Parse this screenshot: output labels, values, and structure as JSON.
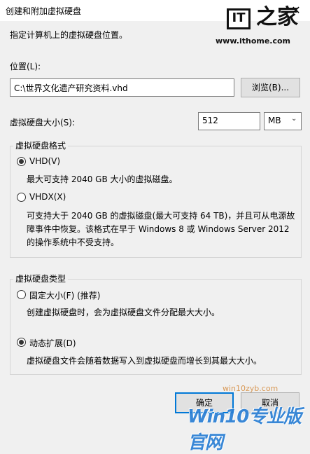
{
  "window": {
    "title": "创建和附加虚拟硬盘",
    "close_glyph": "✕"
  },
  "watermark_logo": {
    "mark": "IT",
    "cn": "之家",
    "url": "www.ithome.com"
  },
  "intro_text": "指定计算机上的虚拟硬盘位置。",
  "location": {
    "label": "位置(L):",
    "value": "C:\\世界文化遗产研究资料.vhd",
    "browse_label": "浏览(B)..."
  },
  "size": {
    "label": "虚拟硬盘大小(S):",
    "value": "512",
    "unit": "MB",
    "arrow": "⌄"
  },
  "format_group": {
    "title": "虚拟硬盘格式",
    "options": [
      {
        "label": "VHD(V)",
        "selected": true,
        "description": [
          "最大可支持 2040 GB 大小的虚拟磁盘。"
        ]
      },
      {
        "label": "VHDX(X)",
        "selected": false,
        "description": [
          "可支持大于 2040 GB 的虚拟磁盘(最大可支持 64 TB)，并且可从电源故",
          "障事件中恢复。该格式在早于 Windows 8 或 Windows Server 2012",
          "的操作系统中不受支持。"
        ]
      }
    ]
  },
  "type_group": {
    "title": "虚拟硬盘类型",
    "options": [
      {
        "label": "固定大小(F) (推荐)",
        "selected": false,
        "description": [
          "创建虚拟硬盘时，会为虚拟硬盘文件分配最大大小。"
        ]
      },
      {
        "label": "动态扩展(D)",
        "selected": true,
        "description": [
          "虚拟硬盘文件会随着数据写入到虚拟硬盘而增长到其最大大小。"
        ]
      }
    ]
  },
  "buttons": {
    "ok": "确定",
    "cancel": "取消"
  },
  "footer_watermark": {
    "site": "win10zyb.com",
    "brand": "Win10专业版官网"
  }
}
